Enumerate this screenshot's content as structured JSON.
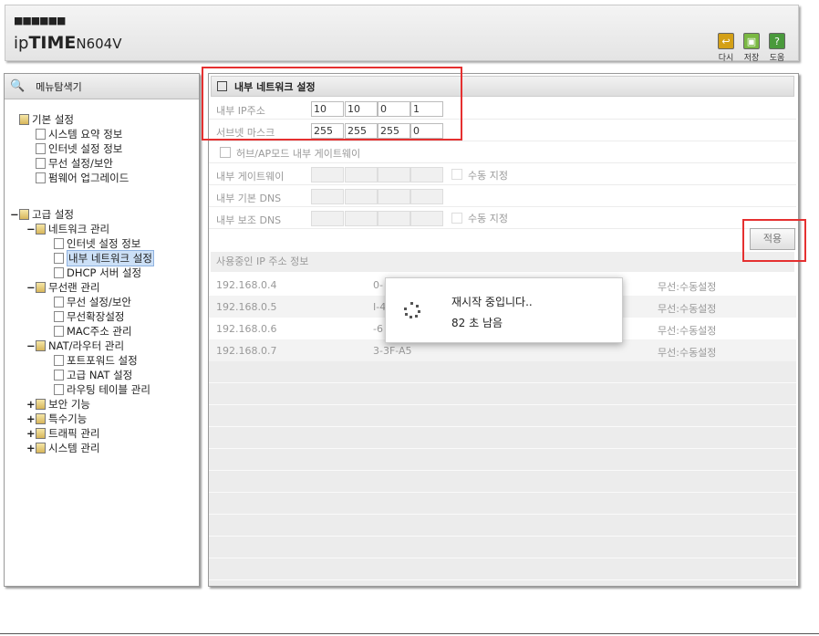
{
  "header": {
    "logo_dots": "■■■■■■",
    "brand_prefix": "ip",
    "brand_bold": "TIME",
    "model": "N604V",
    "buttons": [
      {
        "label": "다시",
        "icon": "refresh-icon",
        "color": "#d4a017"
      },
      {
        "label": "저장",
        "icon": "save-icon",
        "color": "#7ab842"
      },
      {
        "label": "도움",
        "icon": "help-icon",
        "color": "#4a9a3c"
      }
    ]
  },
  "sidebar": {
    "title": "메뉴탐색기",
    "items": [
      {
        "label": "기본 설정",
        "expander": ""
      },
      {
        "label": "시스템 요약 정보"
      },
      {
        "label": "인터넷 설정 정보"
      },
      {
        "label": "무선 설정/보안"
      },
      {
        "label": "펌웨어 업그레이드"
      },
      {
        "label": "고급 설정",
        "expander": "−"
      },
      {
        "label": "네트워크 관리",
        "expander": "−"
      },
      {
        "label": "인터넷 설정 정보"
      },
      {
        "label": "내부 네트워크 설정"
      },
      {
        "label": "DHCP 서버 설정"
      },
      {
        "label": "무선랜 관리",
        "expander": "−"
      },
      {
        "label": "무선 설정/보안"
      },
      {
        "label": "무선확장설정"
      },
      {
        "label": "MAC주소 관리"
      },
      {
        "label": "NAT/라우터 관리",
        "expander": "−"
      },
      {
        "label": "포트포워드 설정"
      },
      {
        "label": "고급 NAT 설정"
      },
      {
        "label": "라우팅 테이블 관리"
      },
      {
        "label": "보안 기능",
        "expander": "+"
      },
      {
        "label": "특수기능",
        "expander": "+"
      },
      {
        "label": "트래픽 관리",
        "expander": "+"
      },
      {
        "label": "시스템 관리",
        "expander": "+"
      }
    ]
  },
  "main": {
    "title": "내부 네트워크 설정",
    "internal_ip_label": "내부 IP주소",
    "internal_ip": [
      "10",
      "10",
      "0",
      "1"
    ],
    "subnet_label": "서브넷 마스크",
    "subnet": [
      "255",
      "255",
      "255",
      "0"
    ],
    "hub_ap_label": "허브/AP모드 내부 게이트웨이",
    "gateway_label": "내부 게이트웨이",
    "manual_label": "수동 지정",
    "dns1_label": "내부 기본 DNS",
    "dns2_label": "내부 보조 DNS",
    "manual_label2": "수동 지정",
    "apply_label": "적용",
    "ip_section_title": "사용중인 IP 주소 정보",
    "ip_rows": [
      {
        "ip": "192.168.0.4",
        "mac": "0-",
        "type": "무선:수동설정"
      },
      {
        "ip": "192.168.0.5",
        "mac": "I-4",
        "type": "무선:수동설정"
      },
      {
        "ip": "192.168.0.6",
        "mac": "-6",
        "type": "무선:수동설정"
      },
      {
        "ip": "192.168.0.7",
        "mac": "3-3F-A5",
        "type": "무선:수동설정"
      }
    ]
  },
  "popup": {
    "message": "재시작 중입니다..",
    "remaining": "82 초 남음"
  },
  "colors": {
    "highlight_box": "#e53030",
    "selected_item": "#cce0f7"
  }
}
